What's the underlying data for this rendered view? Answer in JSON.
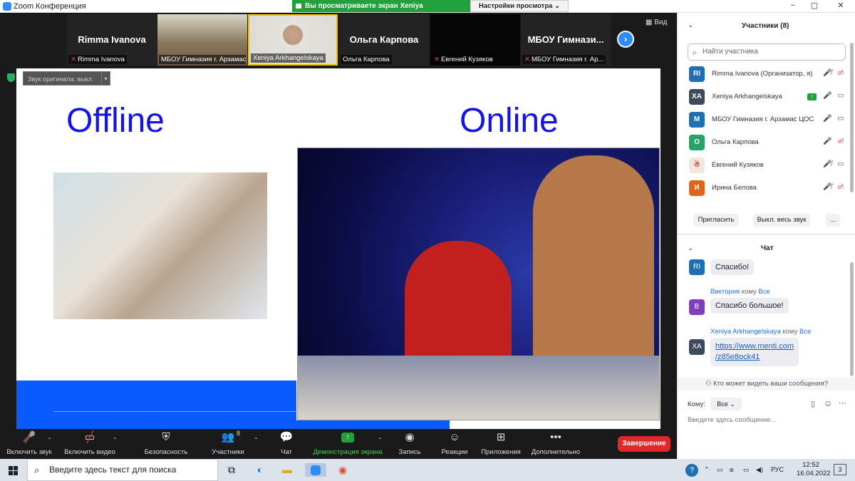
{
  "window": {
    "title": "Zoom Конференция",
    "controls": [
      "–",
      "▢",
      "✕"
    ]
  },
  "share_banner": {
    "text": "Вы просматриваете экран Xeniya Arkhangelskaya",
    "view_options": "Настройки просмотра ⌄"
  },
  "strip": {
    "tiles": [
      {
        "big": "Rimma Ivanova",
        "name": "Rimma Ivanova",
        "muted": true
      },
      {
        "big": "",
        "name": "МБОУ Гимназия г. Арзамас",
        "muted": false
      },
      {
        "big": "",
        "name": "Xeniya Arkhangelskaya",
        "muted": false
      },
      {
        "big": "Ольга Карпова",
        "name": "Ольга Карпова",
        "muted": false
      },
      {
        "big": "",
        "name": "Евгений Кузяков",
        "muted": true
      },
      {
        "big": "МБОУ Гимнази...",
        "name": "МБОУ Гимназия г. Ар...",
        "muted": true
      }
    ],
    "view_label": "Вид"
  },
  "original_sound": "Звук оригинала: выкл.",
  "slide": {
    "left_title": "Offline",
    "right_title": "Online",
    "title_color": "#1414e6"
  },
  "toolbar": {
    "audio": "Включить звук",
    "video": "Включить видео",
    "security": "Безопасность",
    "participants": "Участники",
    "participants_count": "8",
    "chat": "Чат",
    "share": "Демонстрация экрана",
    "record": "Запись",
    "reactions": "Реакции",
    "apps": "Приложения",
    "more": "Дополнительно",
    "end": "Завершение"
  },
  "participants_panel": {
    "header": "Участники (8)",
    "search_placeholder": "Найти участника",
    "people": [
      {
        "initials": "RI",
        "color": "#1f6fb5",
        "name": "Rimma Ivanova (Организатор, я)",
        "mic": "muted",
        "cam": "off"
      },
      {
        "initials": "XA",
        "color": "#3d4a5c",
        "name": "Xeniya Arkhangelskaya",
        "mic": "on",
        "cam": "on",
        "sharing": true
      },
      {
        "initials": "M",
        "color": "#1f6fb5",
        "name": "МБОУ Гимназия г. Арзамас ЦОС",
        "mic": "on",
        "cam": "on"
      },
      {
        "initials": "О",
        "color": "#27a36a",
        "name": "Ольга Карпова",
        "mic": "on",
        "cam": "off"
      },
      {
        "initials": "",
        "color": "#f2e6e0",
        "name": "Евгений Кузяков",
        "mic": "muted",
        "cam": "on"
      },
      {
        "initials": "И",
        "color": "#e0641b",
        "name": "Ирина Белова",
        "mic": "muted",
        "cam": "off"
      }
    ],
    "invite": "Пригласить",
    "mute_all": "Выкл. весь звук",
    "more": "..."
  },
  "chat_panel": {
    "header": "Чат",
    "messages": [
      {
        "initials": "RI",
        "color": "#1f6fb5",
        "sender": "",
        "to": "",
        "to_target": "",
        "text": "Спасибо!"
      },
      {
        "initials": "В",
        "color": "#7e3fbf",
        "sender": "Виктория",
        "to": "кому",
        "to_target": "Все",
        "text": "Спасибо большое!"
      },
      {
        "initials": "XA",
        "color": "#3d4a5c",
        "sender": "Xeniya Arkhangelskaya",
        "to": "кому",
        "to_target": "Все",
        "text_line1": "https://www.menti.com",
        "text_line2": "/z85e8ock41"
      }
    ],
    "privacy": "Кто может видеть ваши сообщения?",
    "to_label": "Кому:",
    "to_value": "Все ⌄",
    "input_placeholder": "Введите здесь сообщение..."
  },
  "taskbar": {
    "search_text": "Введите здесь текст для поиска",
    "lang": "РУС",
    "time": "12:52",
    "date": "16.04.2022"
  }
}
